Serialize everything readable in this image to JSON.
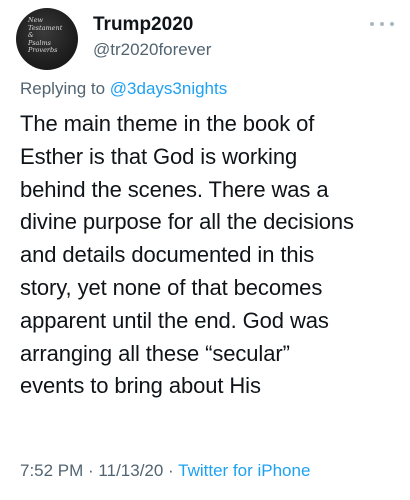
{
  "tweet": {
    "display_name": "Trump2020",
    "handle": "@tr2020forever",
    "avatar_text": "New\nTestament\n&\nPsalms\nProverbs",
    "reply_prefix": "Replying to",
    "reply_mention": "@3days3nights",
    "text": "The main theme in the book of\nEsther is that God is working\nbehind the scenes. There was a\ndivine purpose for all the decisions\nand details documented in this\nstory, yet none of that becomes\napparent until the end. God was\narranging all these “secular”\nevents to bring about His",
    "timestamp": "7:52 PM · 11/13/20 ·",
    "source": "Twitter for iPhone"
  },
  "icons": {
    "avatar": "bible-cover-avatar",
    "more": "more-horizontal-icon"
  },
  "colors": {
    "text_primary": "#0f1419",
    "text_secondary": "#536471",
    "link": "#1da1f2",
    "background": "#ffffff"
  }
}
